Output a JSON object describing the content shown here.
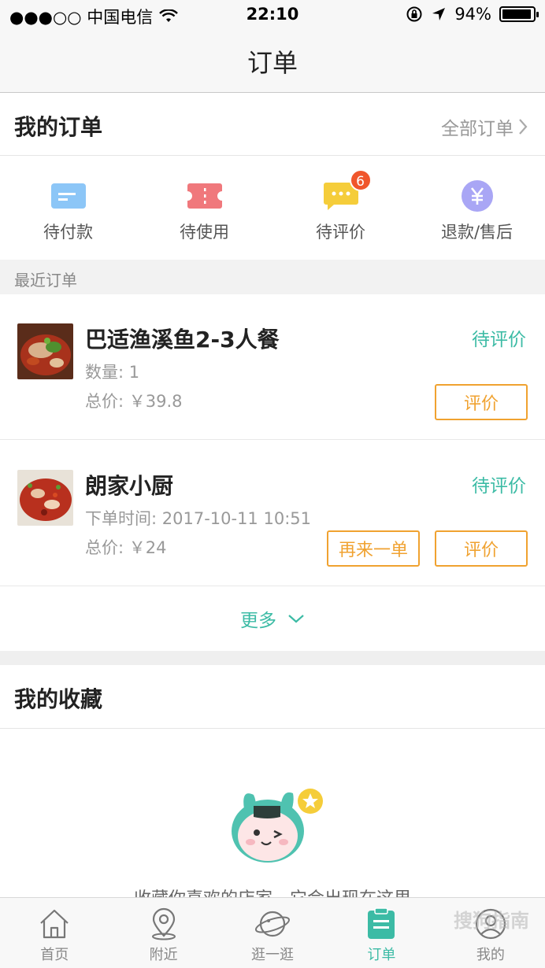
{
  "status_bar": {
    "carrier": "●●●○○ 中国电信",
    "time": "22:10",
    "battery_percent": "94%",
    "battery_level": 0.94
  },
  "nav": {
    "title": "订单"
  },
  "orders_section": {
    "title": "我的订单",
    "all_link": "全部订单",
    "statuses": [
      {
        "label": "待付款",
        "icon": "card-icon",
        "color": "#8cc6f7"
      },
      {
        "label": "待使用",
        "icon": "ticket-icon",
        "color": "#f0787c"
      },
      {
        "label": "待评价",
        "icon": "chat-bubble-icon",
        "color": "#f5cd3a",
        "badge": "6"
      },
      {
        "label": "退款/售后",
        "icon": "yen-icon",
        "color": "#a9a6f5"
      }
    ],
    "recent_label": "最近订单",
    "orders": [
      {
        "name": "巴适渔溪鱼2-3人餐",
        "state": "待评价",
        "line1": "数量: 1",
        "line2": "总价: ￥39.8",
        "review_button": "评价"
      },
      {
        "name": "朗家小厨",
        "state": "待评价",
        "line1": "下单时间:  2017-10-11 10:51",
        "line2": "总价: ￥24",
        "reorder_button": "再来一单",
        "review_button": "评价"
      }
    ],
    "more_label": "更多"
  },
  "favorites_section": {
    "title": "我的收藏",
    "empty_text": "收藏你喜欢的店家，它会出现在这里"
  },
  "tabs": [
    {
      "label": "首页",
      "icon": "home-icon"
    },
    {
      "label": "附近",
      "icon": "location-pin-icon"
    },
    {
      "label": "逛一逛",
      "icon": "planet-icon"
    },
    {
      "label": "订单",
      "icon": "clipboard-icon",
      "active": true
    },
    {
      "label": "我的",
      "icon": "user-icon"
    }
  ],
  "watermark": "搜狗指南",
  "colors": {
    "accent": "#3cbba5",
    "button_orange": "#f0a230",
    "badge_red": "#f0562c"
  }
}
